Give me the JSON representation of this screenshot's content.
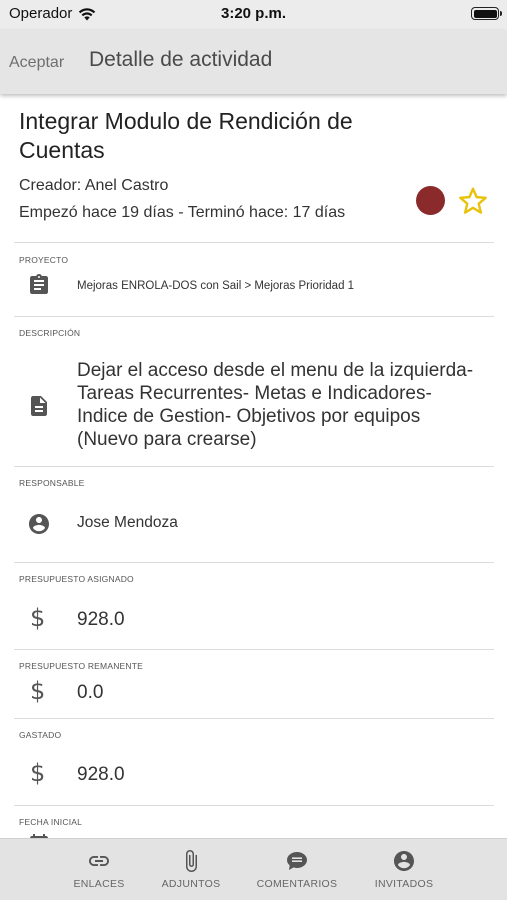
{
  "status_bar": {
    "carrier": "Operador",
    "time": "3:20 p.m."
  },
  "nav": {
    "back_label": "Aceptar",
    "title": "Detalle de actividad"
  },
  "activity": {
    "title": "Integrar Modulo de Rendición de Cuentas",
    "creator": "Creador: Anel Castro",
    "dates": "Empezó hace 19 días - Terminó hace: 17 días",
    "status_color": "#8b2a2a",
    "favorite_color": "#e8c20c"
  },
  "sections": {
    "proyecto": {
      "label": "PROYECTO",
      "icon": "clipboard-icon",
      "value": "Mejoras ENROLA-DOS con Sail > Mejoras Prioridad 1"
    },
    "descripcion": {
      "label": "DESCRIPCIÓN",
      "icon": "document-icon",
      "value": "Dejar el acceso desde el menu de la izquierda- Tareas Recurrentes- Metas e Indicadores- Indice de Gestion- Objetivos por equipos  (Nuevo para crearse)"
    },
    "responsable": {
      "label": "RESPONSABLE",
      "icon": "account-circle-icon",
      "value": "Jose Mendoza"
    },
    "presupuesto_asignado": {
      "label": "PRESUPUESTO ASIGNADO",
      "icon": "dollar-icon",
      "value": "928.0"
    },
    "presupuesto_remanente": {
      "label": "PRESUPUESTO REMANENTE",
      "icon": "dollar-icon",
      "value": "0.0"
    },
    "gastado": {
      "label": "GASTADO",
      "icon": "dollar-icon",
      "value": "928.0"
    },
    "fecha_inicial": {
      "label": "FECHA INICIAL",
      "icon": "calendar-icon"
    }
  },
  "tabs": [
    {
      "label": "ENLACES",
      "icon": "link-icon"
    },
    {
      "label": "ADJUNTOS",
      "icon": "paperclip-icon"
    },
    {
      "label": "COMENTARIOS",
      "icon": "comment-icon"
    },
    {
      "label": "INVITADOS",
      "icon": "account-circle-icon"
    }
  ]
}
